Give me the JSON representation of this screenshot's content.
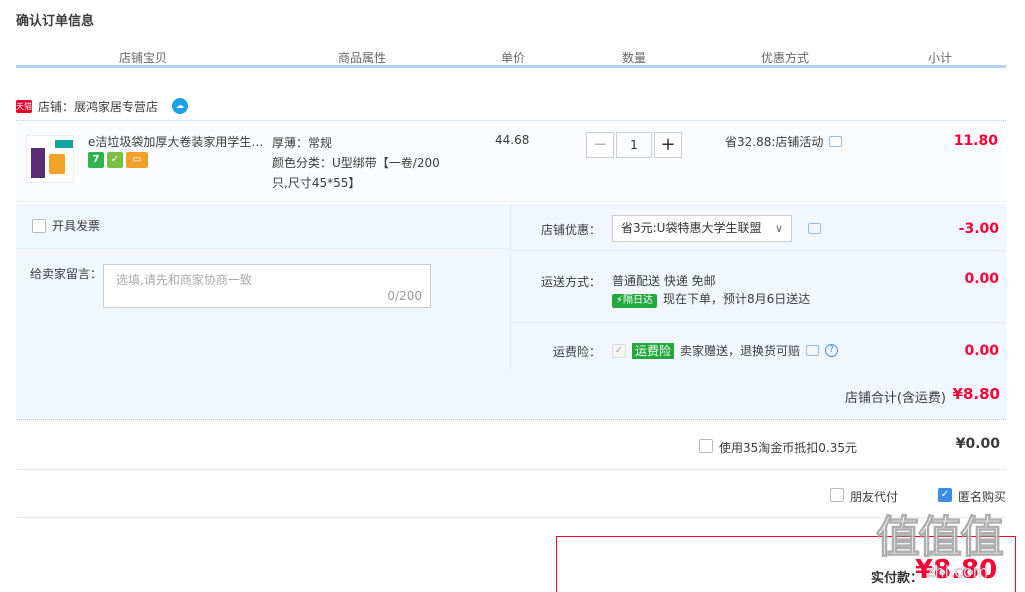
{
  "page_title": "确认订单信息",
  "columns": [
    "店铺宝贝",
    "商品属性",
    "单价",
    "数量",
    "优惠方式",
    "小计"
  ],
  "shop": {
    "badge": "天猫",
    "label": "店铺：",
    "name": "展鸿家居专营店"
  },
  "item": {
    "title": "e洁垃圾袋加厚大卷装家用学生宿...",
    "icon_7": "7",
    "attr_line1": "厚薄：常规",
    "attr_line2": "颜色分类：U型绑带【一卷/200",
    "attr_line3": "只,尺寸45*55】",
    "unit_price": "44.68",
    "quantity": "1",
    "minus": "−",
    "plus": "+",
    "promo": "省32.88:店铺活动",
    "subtotal": "11.80"
  },
  "invoice": {
    "label": "开具发票"
  },
  "message": {
    "label": "给卖家留言：",
    "placeholder": "选填,请先和商家协商一致",
    "counter": "0/200"
  },
  "shop_discount": {
    "label": "店铺优惠：",
    "value": "省3元:U袋特惠大学生联盟",
    "amount": "-3.00"
  },
  "shipping": {
    "label": "运送方式：",
    "method": "普通配送 快递 免邮",
    "badge": "隔日达",
    "eta": "现在下单，预计8月6日送达",
    "amount": "0.00"
  },
  "insurance": {
    "label": "运费险：",
    "badge": "运费险",
    "text": "卖家赠送，退换货可赔",
    "amount": "0.00"
  },
  "shop_total": {
    "label": "店铺合计(含运费)",
    "amount": "¥8.80"
  },
  "coins": {
    "label": "使用35淘金币抵扣0.35元",
    "amount": "¥0.00"
  },
  "options": {
    "friend_pay": "朋友代付",
    "anonymous": "匿名购买"
  },
  "payment": {
    "label": "实付款：",
    "amount": "¥8.80"
  },
  "watermark": {
    "chars": "值值值",
    "url": "zhi.com"
  },
  "colors": {
    "accent": "#ff0036",
    "header_rule": "#b2d1ff",
    "panel_bg": "#f2f7ff",
    "checkbox": "#3c8ee5"
  }
}
